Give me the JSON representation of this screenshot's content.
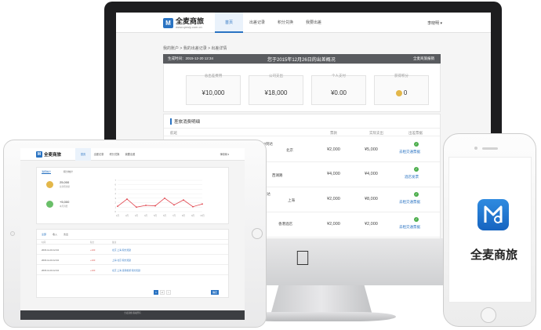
{
  "brand": {
    "name": "全麦商旅",
    "sub": "www.qmsly.com.cn"
  },
  "desktop": {
    "tabs": [
      "首页",
      "出差记录",
      "积分兑换",
      "我要出差"
    ],
    "user": "李晓明",
    "breadcrumb": "我的账户 > 我的出差记录 > 出差详情",
    "bar": {
      "left": "生成时间：2015-12-20 12:34",
      "center": "您于2015年12月26日的出差概况",
      "right": "全麦商旅报销"
    },
    "stats": [
      {
        "label": "总出差费用",
        "value": "¥10,000"
      },
      {
        "label": "公司支出",
        "value": "¥18,000"
      },
      {
        "label": "个人支付",
        "value": "¥0.00"
      },
      {
        "label": "获得积分",
        "value": "0"
      }
    ],
    "table_title": "差旅消费明细",
    "columns": [
      "航班",
      "票款",
      "实际支出",
      "出差票据"
    ],
    "rows": [
      {
        "time": "2015-11-21",
        "detail": "重庆2015-11-21 12:",
        "note": "30到达",
        "dest": "北京",
        "fare": "¥2,000",
        "paid": "¥5,000",
        "status": "去租交通票据"
      },
      {
        "time": "",
        "detail": "",
        "note": "西湖路",
        "dest": "",
        "fare": "¥4,000",
        "paid": "¥4,000",
        "status": "酒店发票"
      },
      {
        "time": "",
        "detail": "",
        "note": "30到达",
        "dest": "上海",
        "fare": "¥2,000",
        "paid": "¥8,000",
        "status": "去租交通票据"
      },
      {
        "time": "",
        "detail": "",
        "note": "",
        "dest": "香港酒店",
        "fare": "¥2,000",
        "paid": "¥2,000",
        "status": "去租交通票据"
      }
    ]
  },
  "tablet": {
    "tabs": [
      "首页",
      "出差记录",
      "积分兑换",
      "我要出差"
    ],
    "user": "李晓明",
    "panel_tabs": [
      "消费统计",
      "积分统计"
    ],
    "stats": [
      {
        "value": "25,000",
        "sub": "总消费金额"
      },
      {
        "value": "+5,000",
        "sub": "本月消费"
      }
    ],
    "list_tabs": [
      "全部",
      "收入",
      "支出"
    ],
    "list_headers": [
      "时间",
      "积分",
      "备注"
    ],
    "list_rows": [
      {
        "time": "2015-11-19 12:34",
        "pts": "+100",
        "note": "北京 上海 积分奖励"
      },
      {
        "time": "2015-11-19 12:34",
        "pts": "+100",
        "note": "上海 北京 积分奖励"
      },
      {
        "time": "2015-11-19 12:34",
        "pts": "+100",
        "note": "北京 上海 香港旅游 积分奖励"
      }
    ],
    "pager": [
      "1",
      "2",
      ">"
    ],
    "go": "确定",
    "footer": "全麦商旅 版权所有"
  },
  "phone": {
    "app_name": "全麦商旅"
  },
  "chart_data": {
    "type": "line",
    "x": [
      "1月",
      "2月",
      "3月",
      "4月",
      "5月",
      "6月",
      "7月",
      "8月",
      "9月",
      "10月"
    ],
    "series": [
      {
        "values": [
          1.2,
          2.8,
          1.0,
          1.4,
          1.3,
          3.0,
          1.5,
          2.6,
          1.1,
          1.7
        ]
      }
    ],
    "ylim": [
      0,
      7
    ],
    "grid": true
  },
  "colors": {
    "accent": "#2a73c2",
    "chart_line": "#e0444d",
    "dark_bar": "#595b5f"
  }
}
